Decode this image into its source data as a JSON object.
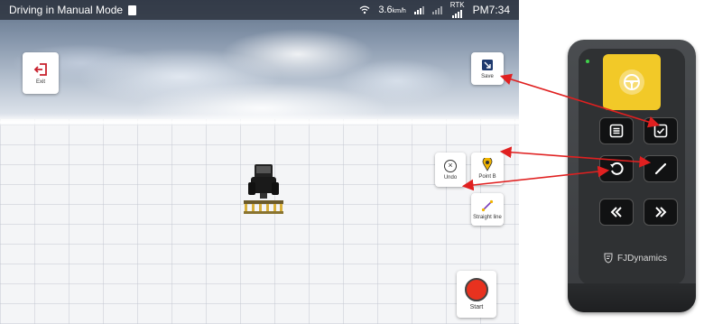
{
  "status_bar": {
    "title": "Driving in Manual Mode",
    "speed": "3.6",
    "speed_unit": "km/h",
    "rtk_label": "RTK",
    "time": "PM7:34"
  },
  "buttons": {
    "exit_label": "Exit",
    "save_label": "Save",
    "undo_label": "Undo",
    "point_b_label": "Point B",
    "straight_line_label": "Straight line",
    "start_label": "Start"
  },
  "remote": {
    "brand": "FJDynamics",
    "buttons": [
      "steering-wheel",
      "menu",
      "confirm",
      "undo",
      "line",
      "previous",
      "next"
    ]
  },
  "colors": {
    "exit_red": "#c8202c",
    "save_navy": "#1f3a6e",
    "start_red": "#e8321f",
    "remote_yellow": "#f2c928",
    "arrow_red": "#e02020"
  }
}
